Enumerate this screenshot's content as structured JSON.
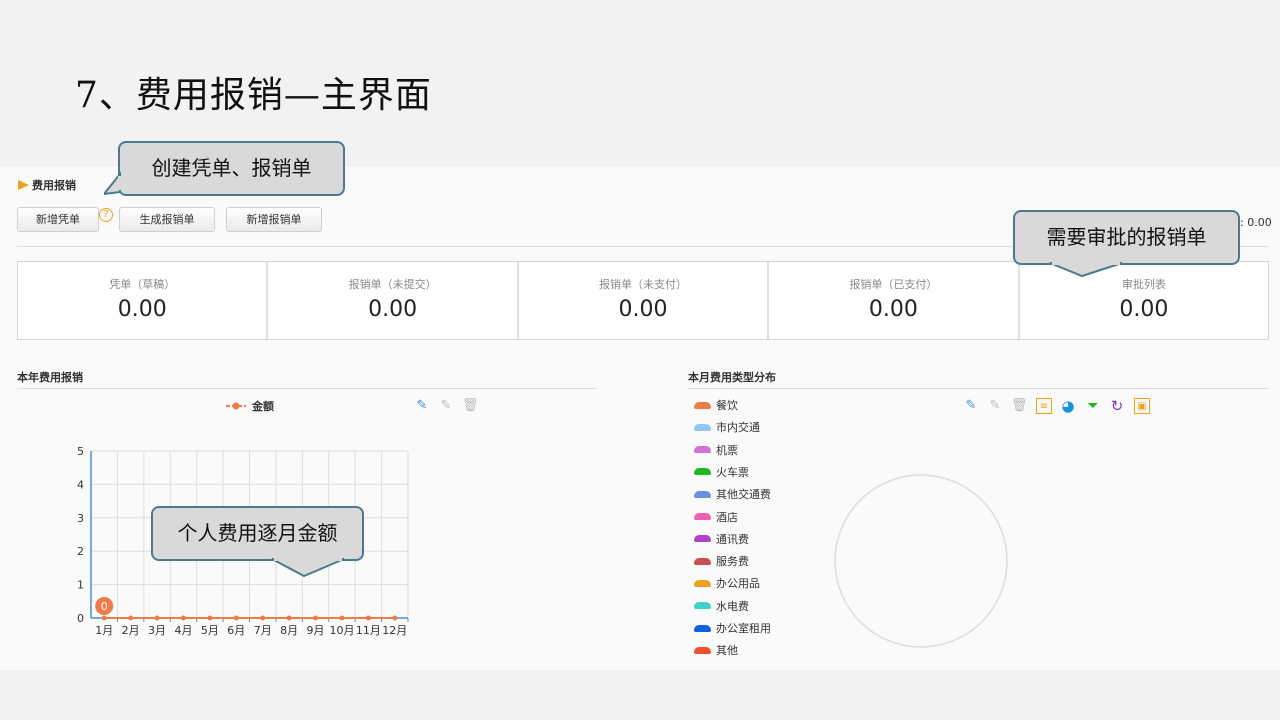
{
  "slide_title": "7、费用报销—主界面",
  "module": {
    "title": "费用报销"
  },
  "toolbar": {
    "new_voucher": "新增凭单",
    "help": "?",
    "generate_report": "生成报销单",
    "new_report": "新增报销单",
    "right_value": ": 0.00"
  },
  "stats": [
    {
      "label": "凭单（草稿）",
      "value": "0.00"
    },
    {
      "label": "报销单（未提交）",
      "value": "0.00"
    },
    {
      "label": "报销单（未支付）",
      "value": "0.00"
    },
    {
      "label": "报销单（已支付）",
      "value": "0.00"
    },
    {
      "label": "审批列表",
      "value": "0.00"
    }
  ],
  "left_section": {
    "title": "本年费用报销",
    "legend": "金额"
  },
  "right_section": {
    "title": "本月费用类型分布"
  },
  "chart_data": {
    "type": "line",
    "categories": [
      "1月",
      "2月",
      "3月",
      "4月",
      "5月",
      "6月",
      "7月",
      "8月",
      "9月",
      "10月",
      "11月",
      "12月"
    ],
    "series": [
      {
        "name": "金额",
        "values": [
          0,
          0,
          0,
          0,
          0,
          0,
          0,
          0,
          0,
          0,
          0,
          0
        ],
        "color": "#f07a4a"
      }
    ],
    "yticks": [
      "0",
      "1",
      "2",
      "3",
      "4",
      "5"
    ],
    "ylim": [
      0,
      5
    ],
    "grid": true,
    "highlight_label": "0"
  },
  "pie_legend": [
    {
      "label": "餐饮",
      "color": "#f07a4a"
    },
    {
      "label": "市内交通",
      "color": "#8ec8f0"
    },
    {
      "label": "机票",
      "color": "#d070d8"
    },
    {
      "label": "火车票",
      "color": "#20b820"
    },
    {
      "label": "其他交通费",
      "color": "#6890e0"
    },
    {
      "label": "酒店",
      "color": "#f060b0"
    },
    {
      "label": "通讯费",
      "color": "#b040c8"
    },
    {
      "label": "服务费",
      "color": "#c85050"
    },
    {
      "label": "办公用品",
      "color": "#f0a020"
    },
    {
      "label": "水电费",
      "color": "#40d0c8"
    },
    {
      "label": "办公室租用",
      "color": "#1060e0"
    },
    {
      "label": "其他",
      "color": "#f05030"
    }
  ],
  "callouts": {
    "create": "创建凭单、报销单",
    "approve": "需要审批的报销单",
    "monthly": "个人费用逐月金额"
  }
}
